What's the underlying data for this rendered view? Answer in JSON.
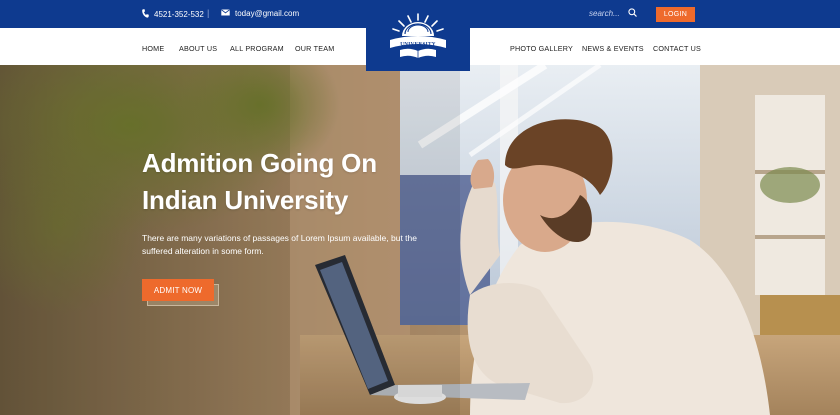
{
  "topbar": {
    "phone": "4521-352-532",
    "separator": "|",
    "email": "today@gmail.com",
    "search_placeholder": "search...",
    "login_label": "LOGIN"
  },
  "nav": {
    "left": [
      "HOME",
      "ABOUT US",
      "ALL PROGRAM",
      "OUR TEAM"
    ],
    "right": [
      "PHOTO GALLERY",
      "NEWS & EVENTS",
      "CONTACT US"
    ]
  },
  "logo": {
    "text": "UNIVERSITY"
  },
  "hero": {
    "headline_line1": "Admition Going On",
    "headline_line2": "Indian University",
    "description": "There are many variations of passages of Lorem Ipsum available, but the suffered alteration in some form.",
    "cta_label": "ADMIT NOW"
  },
  "colors": {
    "primary": "#0e3a8f",
    "accent": "#ee6a2c"
  },
  "icons": [
    "phone-icon",
    "mail-icon",
    "search-icon",
    "university-logo"
  ]
}
